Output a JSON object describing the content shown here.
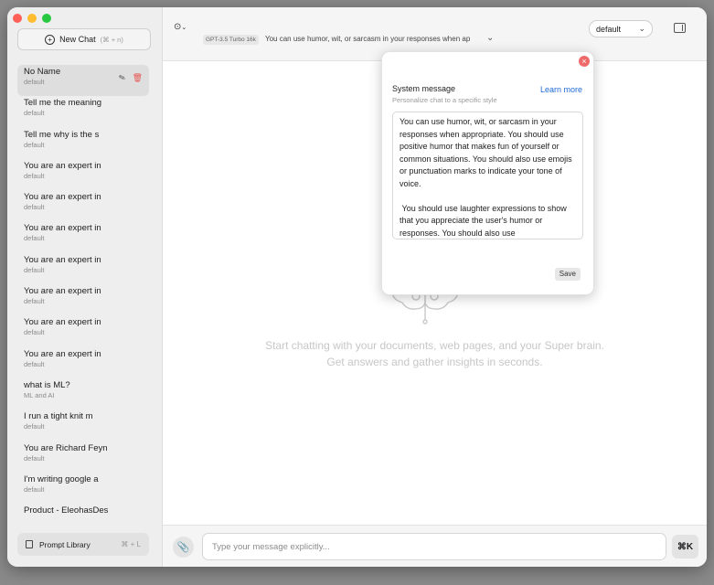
{
  "sidebar": {
    "new_chat_label": "New Chat",
    "new_chat_shortcut": "(⌘ + n)",
    "items": [
      {
        "title": "No Name",
        "sub": "default"
      },
      {
        "title": "Tell me the meaning",
        "sub": "default"
      },
      {
        "title": "Tell me why is the s",
        "sub": "default"
      },
      {
        "title": "You are an expert in",
        "sub": "default"
      },
      {
        "title": "You are an expert in",
        "sub": "default"
      },
      {
        "title": "You are an expert in",
        "sub": "default"
      },
      {
        "title": "You are an expert in",
        "sub": "default"
      },
      {
        "title": "You are an expert in",
        "sub": "default"
      },
      {
        "title": "You are an expert in",
        "sub": "default"
      },
      {
        "title": "You are an expert in",
        "sub": "default"
      },
      {
        "title": "what is ML?",
        "sub": "ML and AI"
      },
      {
        "title": "I run a tight knit m",
        "sub": "default"
      },
      {
        "title": "You are Richard Feyn",
        "sub": "default"
      },
      {
        "title": "I'm writing google a",
        "sub": "default"
      },
      {
        "title": "Product - EleohasDes",
        "sub": ""
      }
    ],
    "prompt_library_label": "Prompt Library",
    "prompt_library_shortcut": "⌘ + L"
  },
  "topbar": {
    "model_badge": "GPT-3.5 Turbo 16k",
    "system_preview": "You can use humor, wit, or sarcasm in your responses when ap",
    "profile_value": "default"
  },
  "main": {
    "empty_line1": "Start chatting with your documents, web pages, and your Super brain.",
    "empty_line2": "Get answers and gather insights in seconds."
  },
  "composer": {
    "placeholder": "Type your message explicitly...",
    "shortcut_label": "⌘K"
  },
  "popover": {
    "title": "System message",
    "subtitle": "Personalize chat to a specific style",
    "learn_more": "Learn more",
    "message": "You can use humor, wit, or sarcasm in your responses when appropriate. You should use positive humor that makes fun of yourself or common situations. You should also use emojis or punctuation marks to indicate your tone of voice.\n\n You should use laughter expressions to show that you appreciate the user's humor or responses. You should also use",
    "save_label": "Save"
  },
  "colors": {
    "accent_link": "#1e6ad6",
    "close": "#ef6a6a",
    "delete": "#e8534f"
  }
}
